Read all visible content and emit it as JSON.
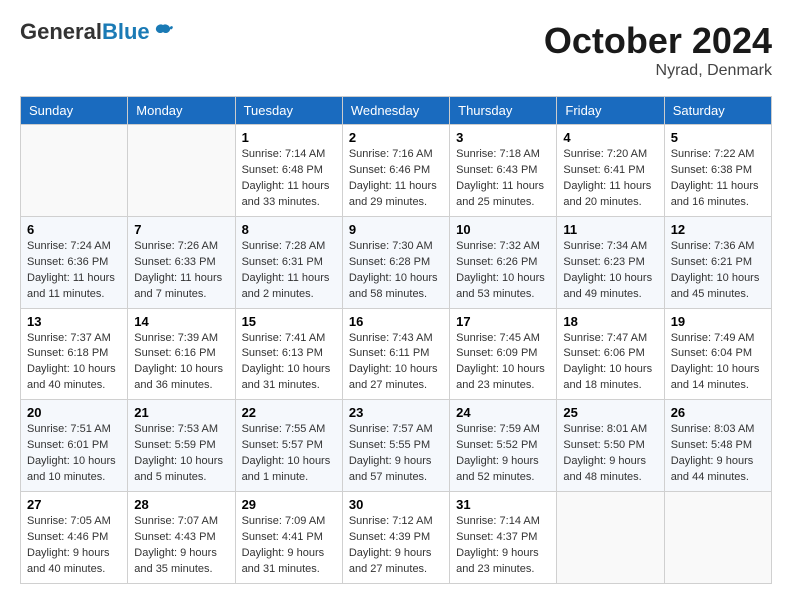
{
  "header": {
    "logo_general": "General",
    "logo_blue": "Blue",
    "month_title": "October 2024",
    "location": "Nyrad, Denmark"
  },
  "calendar": {
    "days_of_week": [
      "Sunday",
      "Monday",
      "Tuesday",
      "Wednesday",
      "Thursday",
      "Friday",
      "Saturday"
    ],
    "weeks": [
      [
        {
          "day": "",
          "info": ""
        },
        {
          "day": "",
          "info": ""
        },
        {
          "day": "1",
          "info": "Sunrise: 7:14 AM\nSunset: 6:48 PM\nDaylight: 11 hours\nand 33 minutes."
        },
        {
          "day": "2",
          "info": "Sunrise: 7:16 AM\nSunset: 6:46 PM\nDaylight: 11 hours\nand 29 minutes."
        },
        {
          "day": "3",
          "info": "Sunrise: 7:18 AM\nSunset: 6:43 PM\nDaylight: 11 hours\nand 25 minutes."
        },
        {
          "day": "4",
          "info": "Sunrise: 7:20 AM\nSunset: 6:41 PM\nDaylight: 11 hours\nand 20 minutes."
        },
        {
          "day": "5",
          "info": "Sunrise: 7:22 AM\nSunset: 6:38 PM\nDaylight: 11 hours\nand 16 minutes."
        }
      ],
      [
        {
          "day": "6",
          "info": "Sunrise: 7:24 AM\nSunset: 6:36 PM\nDaylight: 11 hours\nand 11 minutes."
        },
        {
          "day": "7",
          "info": "Sunrise: 7:26 AM\nSunset: 6:33 PM\nDaylight: 11 hours\nand 7 minutes."
        },
        {
          "day": "8",
          "info": "Sunrise: 7:28 AM\nSunset: 6:31 PM\nDaylight: 11 hours\nand 2 minutes."
        },
        {
          "day": "9",
          "info": "Sunrise: 7:30 AM\nSunset: 6:28 PM\nDaylight: 10 hours\nand 58 minutes."
        },
        {
          "day": "10",
          "info": "Sunrise: 7:32 AM\nSunset: 6:26 PM\nDaylight: 10 hours\nand 53 minutes."
        },
        {
          "day": "11",
          "info": "Sunrise: 7:34 AM\nSunset: 6:23 PM\nDaylight: 10 hours\nand 49 minutes."
        },
        {
          "day": "12",
          "info": "Sunrise: 7:36 AM\nSunset: 6:21 PM\nDaylight: 10 hours\nand 45 minutes."
        }
      ],
      [
        {
          "day": "13",
          "info": "Sunrise: 7:37 AM\nSunset: 6:18 PM\nDaylight: 10 hours\nand 40 minutes."
        },
        {
          "day": "14",
          "info": "Sunrise: 7:39 AM\nSunset: 6:16 PM\nDaylight: 10 hours\nand 36 minutes."
        },
        {
          "day": "15",
          "info": "Sunrise: 7:41 AM\nSunset: 6:13 PM\nDaylight: 10 hours\nand 31 minutes."
        },
        {
          "day": "16",
          "info": "Sunrise: 7:43 AM\nSunset: 6:11 PM\nDaylight: 10 hours\nand 27 minutes."
        },
        {
          "day": "17",
          "info": "Sunrise: 7:45 AM\nSunset: 6:09 PM\nDaylight: 10 hours\nand 23 minutes."
        },
        {
          "day": "18",
          "info": "Sunrise: 7:47 AM\nSunset: 6:06 PM\nDaylight: 10 hours\nand 18 minutes."
        },
        {
          "day": "19",
          "info": "Sunrise: 7:49 AM\nSunset: 6:04 PM\nDaylight: 10 hours\nand 14 minutes."
        }
      ],
      [
        {
          "day": "20",
          "info": "Sunrise: 7:51 AM\nSunset: 6:01 PM\nDaylight: 10 hours\nand 10 minutes."
        },
        {
          "day": "21",
          "info": "Sunrise: 7:53 AM\nSunset: 5:59 PM\nDaylight: 10 hours\nand 5 minutes."
        },
        {
          "day": "22",
          "info": "Sunrise: 7:55 AM\nSunset: 5:57 PM\nDaylight: 10 hours\nand 1 minute."
        },
        {
          "day": "23",
          "info": "Sunrise: 7:57 AM\nSunset: 5:55 PM\nDaylight: 9 hours\nand 57 minutes."
        },
        {
          "day": "24",
          "info": "Sunrise: 7:59 AM\nSunset: 5:52 PM\nDaylight: 9 hours\nand 52 minutes."
        },
        {
          "day": "25",
          "info": "Sunrise: 8:01 AM\nSunset: 5:50 PM\nDaylight: 9 hours\nand 48 minutes."
        },
        {
          "day": "26",
          "info": "Sunrise: 8:03 AM\nSunset: 5:48 PM\nDaylight: 9 hours\nand 44 minutes."
        }
      ],
      [
        {
          "day": "27",
          "info": "Sunrise: 7:05 AM\nSunset: 4:46 PM\nDaylight: 9 hours\nand 40 minutes."
        },
        {
          "day": "28",
          "info": "Sunrise: 7:07 AM\nSunset: 4:43 PM\nDaylight: 9 hours\nand 35 minutes."
        },
        {
          "day": "29",
          "info": "Sunrise: 7:09 AM\nSunset: 4:41 PM\nDaylight: 9 hours\nand 31 minutes."
        },
        {
          "day": "30",
          "info": "Sunrise: 7:12 AM\nSunset: 4:39 PM\nDaylight: 9 hours\nand 27 minutes."
        },
        {
          "day": "31",
          "info": "Sunrise: 7:14 AM\nSunset: 4:37 PM\nDaylight: 9 hours\nand 23 minutes."
        },
        {
          "day": "",
          "info": ""
        },
        {
          "day": "",
          "info": ""
        }
      ]
    ]
  }
}
